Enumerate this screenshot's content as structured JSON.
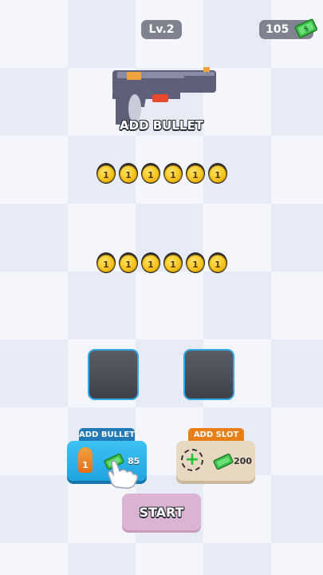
{
  "hud": {
    "level": "Lv.2",
    "money": "105"
  },
  "weapon": {
    "caption": "ADD BULLET"
  },
  "bullet_rows": [
    {
      "bullets": [
        "1",
        "1",
        "1",
        "1",
        "1",
        "1"
      ]
    },
    {
      "bullets": [
        "1",
        "1",
        "1",
        "1",
        "1",
        "1"
      ]
    }
  ],
  "actions": {
    "add_bullet": {
      "tab_label": "ADD BULLET",
      "bullet_level": "1",
      "price": "85"
    },
    "add_slot": {
      "tab_label": "ADD SLOT",
      "price": "200"
    }
  },
  "start_label": "START",
  "colors": {
    "add_bullet_button": "#1ea4e0",
    "add_slot_tab": "#e87f19",
    "start_button": "#dbb4d3",
    "slot_border": "#2fa8e8"
  }
}
